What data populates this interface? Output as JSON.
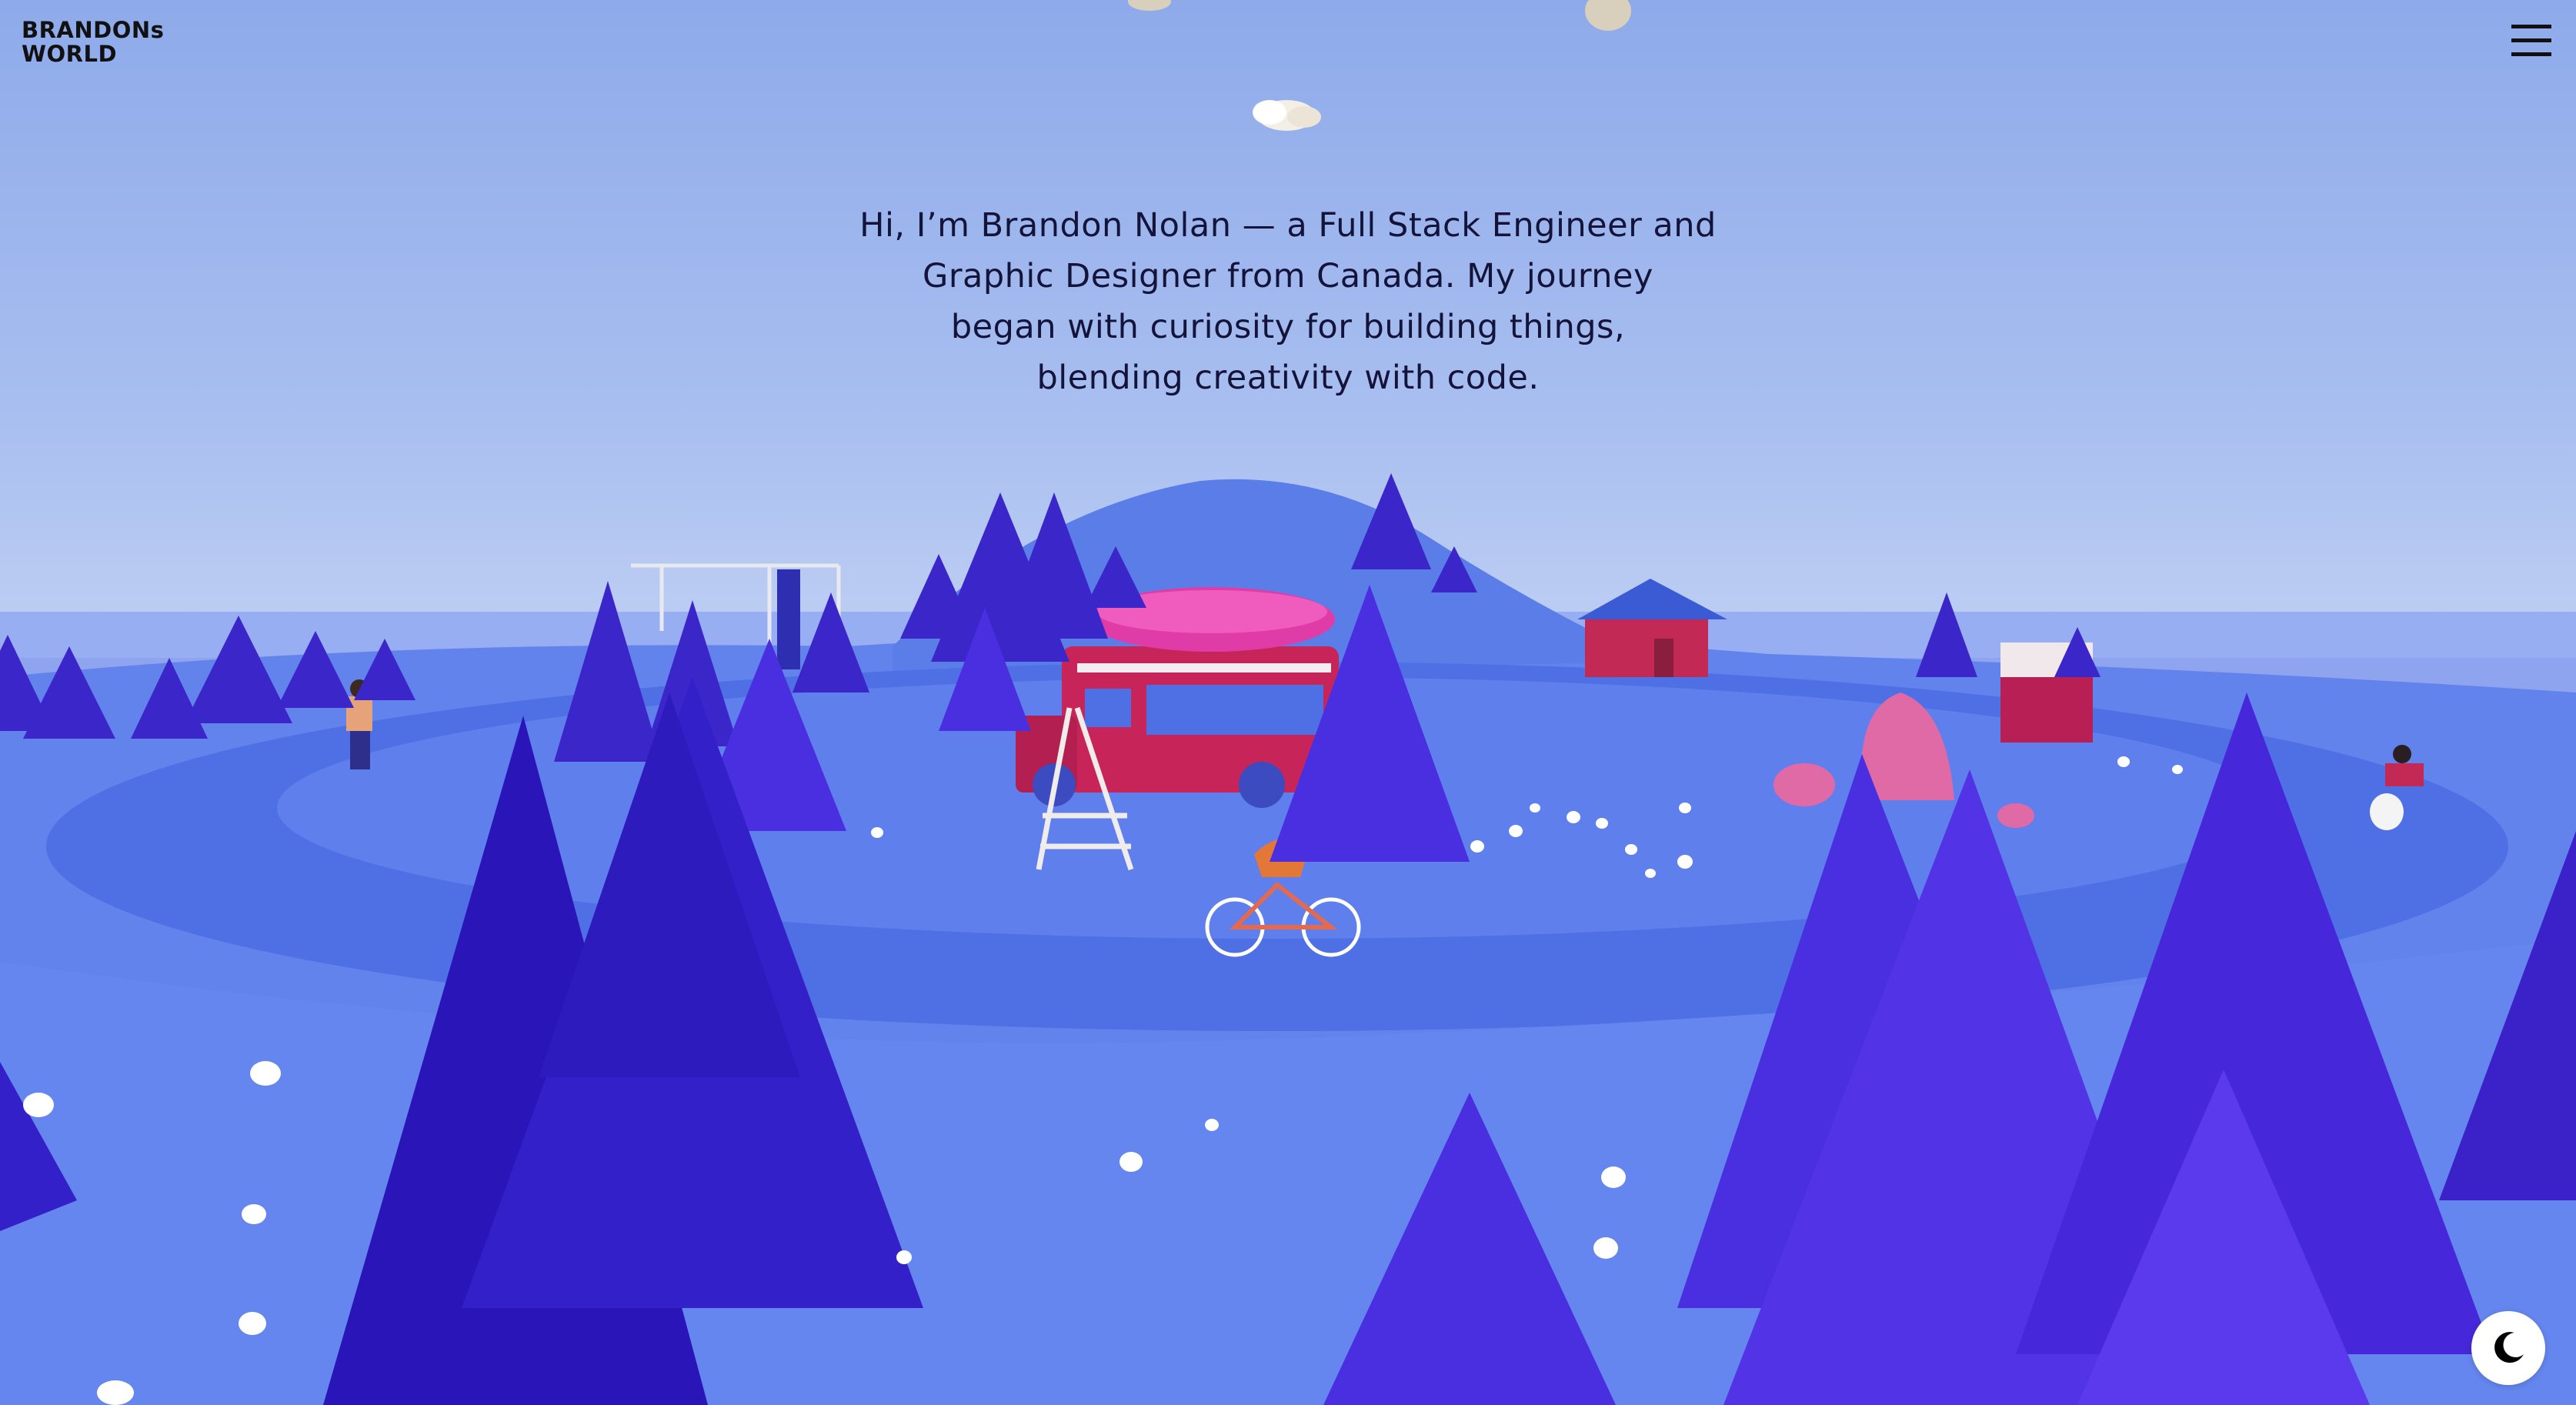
{
  "header": {
    "logo_line1": "BRANDONs",
    "logo_line2": "WORLD"
  },
  "menu": {
    "icon": "hamburger-menu-icon"
  },
  "intro": {
    "line1": "Hi, I’m Brandon Nolan — a Full Stack Engineer and",
    "line2": "Graphic Designer from Canada. My journey",
    "line3": "began with curiosity for building things,",
    "line4": "blending creativity with code."
  },
  "theme_toggle": {
    "icon": "moon-icon"
  },
  "colors": {
    "sky_top": "#8eaaea",
    "sky_bottom": "#eef2fc",
    "ground": "#6383ec",
    "path": "#4e6de2",
    "tree_dark": "#2a16b8",
    "tree_light": "#4a2fe0",
    "truck": "#c7255a",
    "hotdog": "#e03ca8",
    "cabin": "#c22a55",
    "rock": "#e06aa6",
    "text": "#14143a"
  }
}
